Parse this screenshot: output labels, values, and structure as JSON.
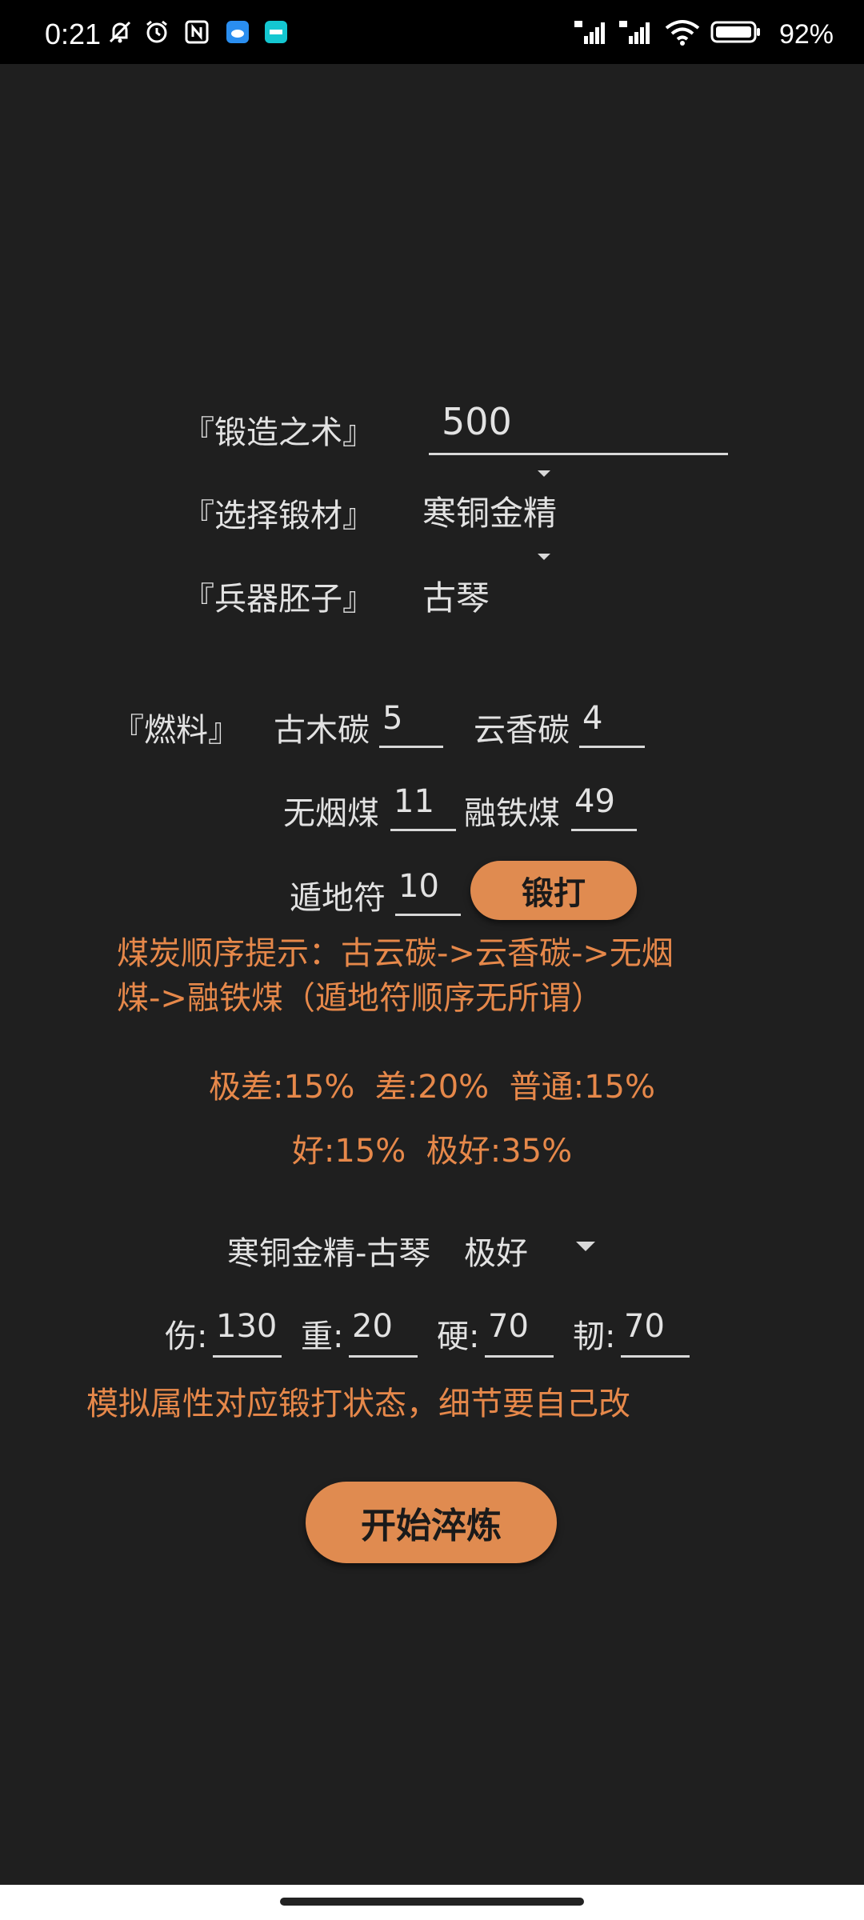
{
  "status_bar": {
    "time": "0:21",
    "battery": "92%",
    "icons": [
      "mute-bell-icon",
      "alarm-icon",
      "nfc-icon",
      "cloud-app-icon",
      "tap-app-icon",
      "signal-hd-1-icon",
      "signal-hd-2-icon",
      "wifi-icon",
      "battery-icon"
    ]
  },
  "forge": {
    "skill_label": "『锻造之术』",
    "skill_value": "500",
    "material_label": "『选择锻材』",
    "material_value": "寒铜金精",
    "blank_label": "『兵器胚子』",
    "blank_value": "古琴"
  },
  "fuel": {
    "label": "『燃料』",
    "items": [
      {
        "name": "古木碳",
        "value": "5"
      },
      {
        "name": "云香碳",
        "value": "4"
      },
      {
        "name": "无烟煤",
        "value": "11"
      },
      {
        "name": "融铁煤",
        "value": "49"
      },
      {
        "name": "遁地符",
        "value": "10"
      }
    ],
    "forge_button": "锻打"
  },
  "hint": "煤炭顺序提示：古云碳->云香碳->无烟煤->融铁煤（遁地符顺序无所谓）",
  "hint_line1": "煤炭顺序提示：古云碳->云香碳->无烟",
  "hint_line2": "煤->融铁煤（遁地符顺序无所谓）",
  "probabilities": {
    "line1": "极差:15%  差:20%  普通:15%",
    "line2": "好:15%  极好:35%"
  },
  "result": {
    "name": "寒铜金精-古琴",
    "quality": "极好"
  },
  "stats": [
    {
      "label": "伤:",
      "value": "130"
    },
    {
      "label": "重:",
      "value": "20"
    },
    {
      "label": "硬:",
      "value": "70"
    },
    {
      "label": "韧:",
      "value": "70"
    }
  ],
  "note": "模拟属性对应锻打状态，细节要自己改",
  "quench_button": "开始淬炼",
  "colors": {
    "accent": "#e08b50",
    "text_orange": "#e6884a",
    "background": "#1f1f1f"
  }
}
